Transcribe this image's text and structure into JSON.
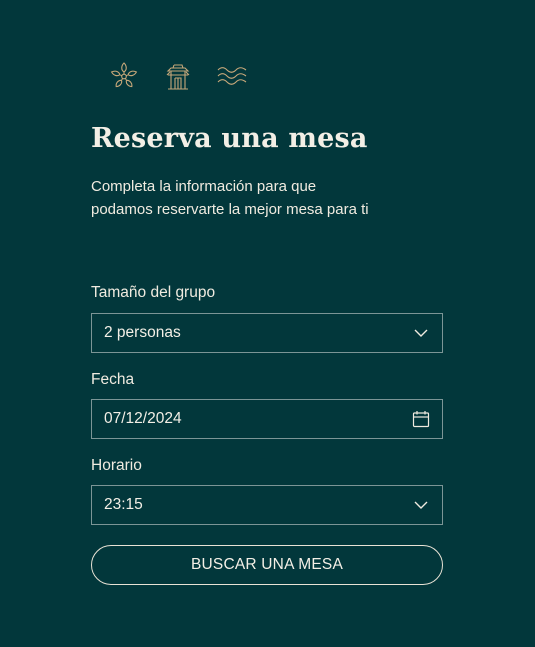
{
  "header": {
    "icons": [
      "sakura-flower-icon",
      "pagoda-gate-icon",
      "waves-icon"
    ],
    "title": "Reserva una mesa",
    "subtitle": "Completa la información para que podamos reservarte la mejor mesa para ti"
  },
  "form": {
    "party_size": {
      "label": "Tamaño del grupo",
      "value": "2 personas"
    },
    "date": {
      "label": "Fecha",
      "value": "07/12/2024"
    },
    "time": {
      "label": "Horario",
      "value": "23:15"
    },
    "submit_label": "BUSCAR UNA MESA"
  },
  "colors": {
    "background": "#02373b",
    "text": "#f0ebe0",
    "border": "#7c9596",
    "accent": "#c7a87a"
  }
}
